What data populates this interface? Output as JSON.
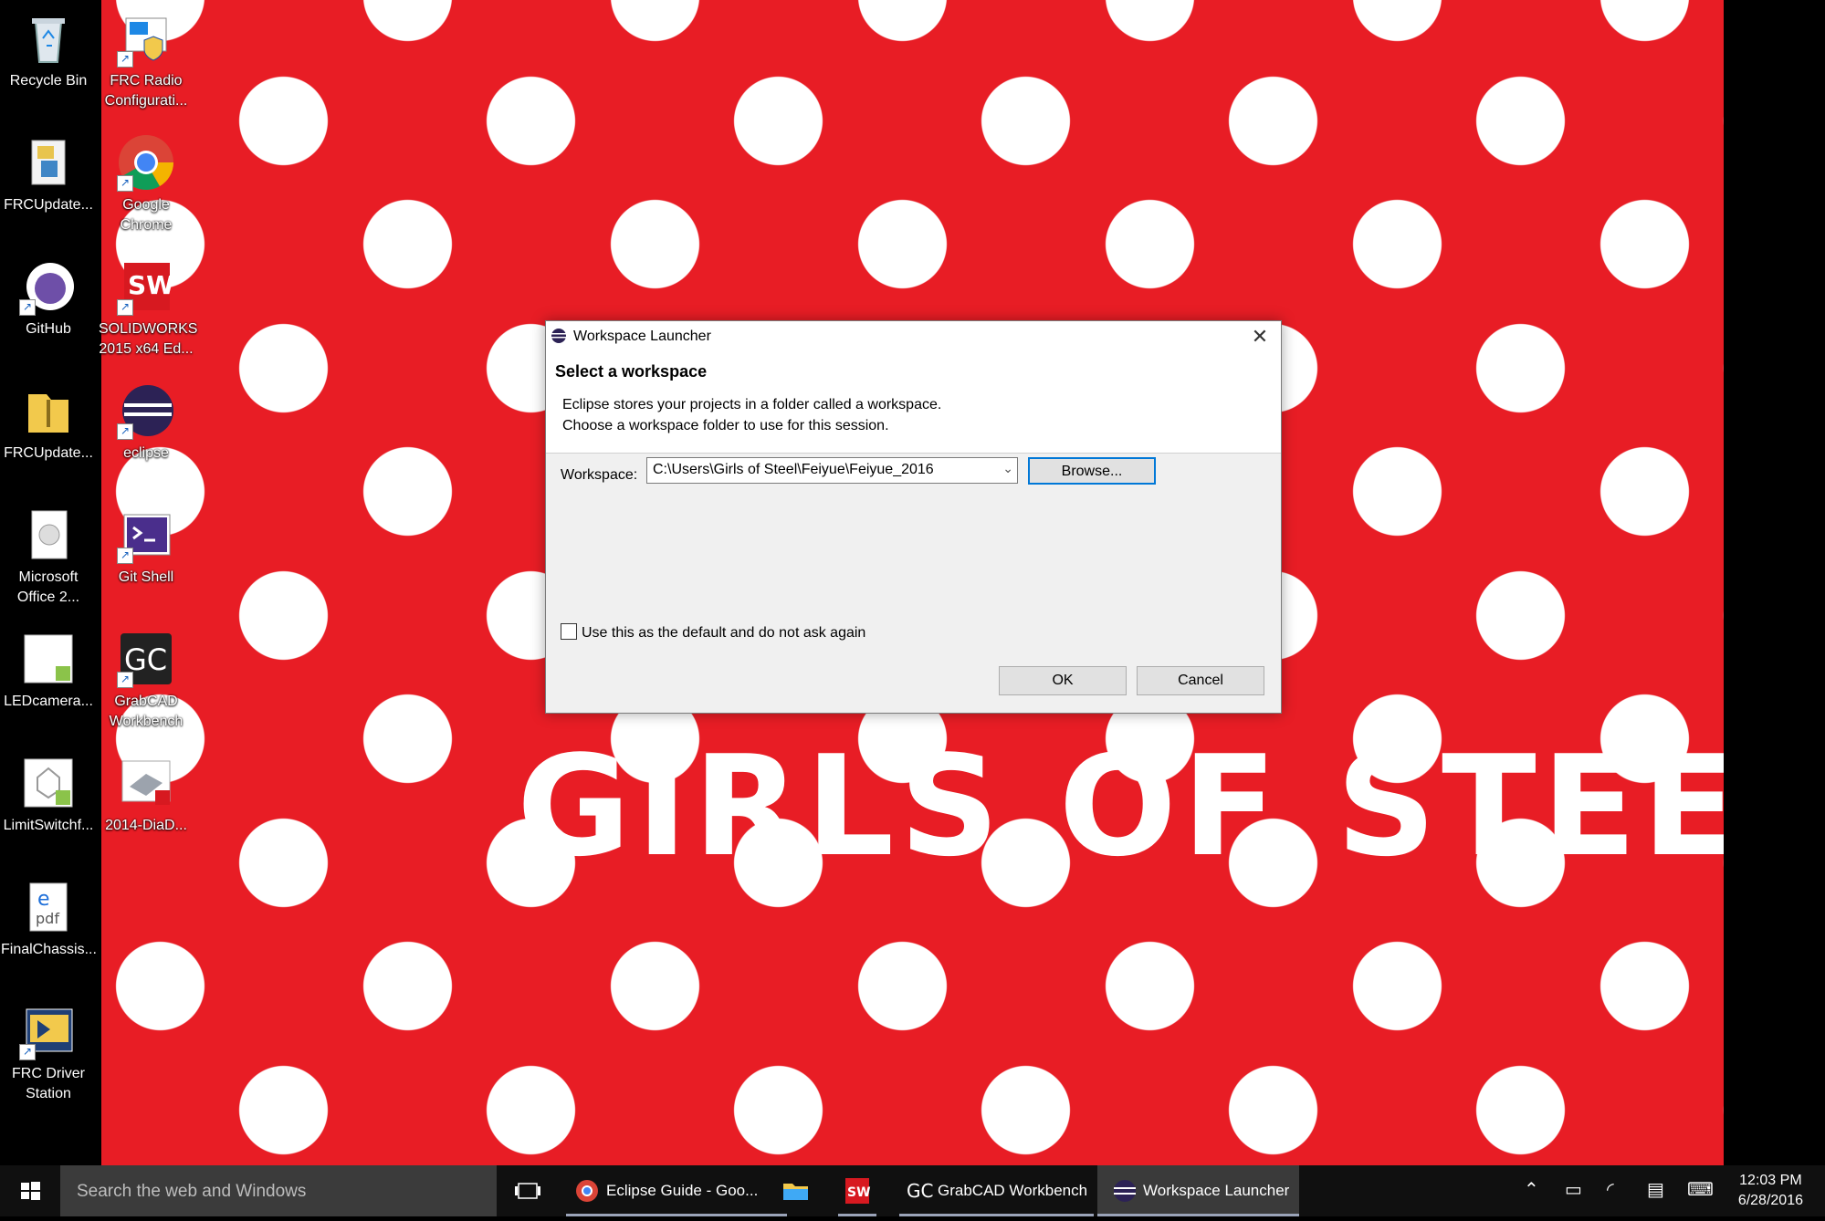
{
  "wallpaper": {
    "brand_text": "GIRLS OF STEEL",
    "color": "#e81d25"
  },
  "desktop_icons": [
    {
      "name": "Recycle Bin",
      "label": "Recycle Bin"
    },
    {
      "name": "FRC Radio Configuration",
      "label": "FRC Radio\nConfigurati..."
    },
    {
      "name": "FRCUpdate 1",
      "label": "FRCUpdate..."
    },
    {
      "name": "Google Chrome",
      "label": "Google\nChrome"
    },
    {
      "name": "GitHub",
      "label": "GitHub"
    },
    {
      "name": "SOLIDWORKS 2015",
      "label": "SOLIDWORKS\n2015 x64 Ed..."
    },
    {
      "name": "FRCUpdate 2",
      "label": "FRCUpdate..."
    },
    {
      "name": "eclipse",
      "label": "eclipse"
    },
    {
      "name": "Microsoft Office",
      "label": "Microsoft\nOffice 2..."
    },
    {
      "name": "Git Shell",
      "label": "Git Shell"
    },
    {
      "name": "LEDcamera",
      "label": "LEDcamera..."
    },
    {
      "name": "GrabCAD Workbench",
      "label": "GrabCAD\nWorkbench"
    },
    {
      "name": "LimitSwitch",
      "label": "LimitSwitchf..."
    },
    {
      "name": "2014 DiaD",
      "label": "2014-DiaD..."
    },
    {
      "name": "FinalChassis",
      "label": "FinalChassis..."
    },
    {
      "name": "FRC Driver Station",
      "label": "FRC Driver\nStation"
    }
  ],
  "dialog": {
    "title": "Workspace Launcher",
    "heading": "Select a workspace",
    "description_line1": "Eclipse stores your projects in a folder called a workspace.",
    "description_line2": "Choose a workspace folder to use for this session.",
    "workspace_label": "Workspace:",
    "workspace_value": "C:\\Users\\Girls of Steel\\Feiyue\\Feiyue_2016",
    "browse_label": "Browse...",
    "default_checkbox_label": "Use this as the default and do not ask again",
    "default_checked": false,
    "ok_label": "OK",
    "cancel_label": "Cancel"
  },
  "taskbar": {
    "search_placeholder": "Search the web and Windows",
    "items": [
      {
        "label": "Eclipse Guide - Goo..."
      },
      {
        "label": ""
      },
      {
        "label": ""
      },
      {
        "label": "GrabCAD Workbench"
      },
      {
        "label": "Workspace Launcher"
      }
    ],
    "clock_time": "12:03 PM",
    "clock_date": "6/28/2016"
  }
}
